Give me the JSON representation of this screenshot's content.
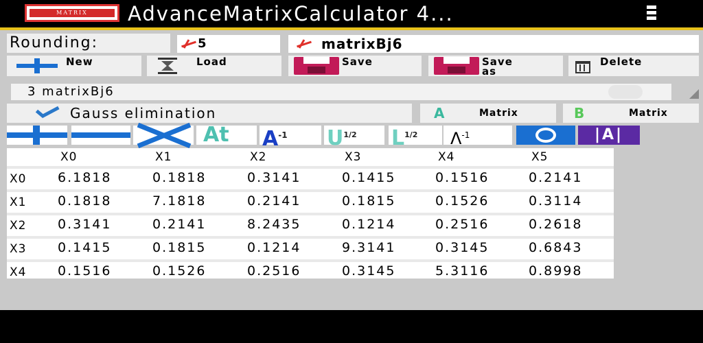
{
  "app": {
    "title": "AdvanceMatrixCalculator 4...",
    "logo_text": "MATRIX"
  },
  "rounding": {
    "label": "Rounding:",
    "value": "5"
  },
  "matrix_name": "matrixBj6",
  "toolbar": {
    "new_label": "New",
    "load_label": "Load",
    "save_label": "Save",
    "saveas_label": "Save as",
    "delete_label": "Delete"
  },
  "selector": {
    "value": "3 matrixBj6"
  },
  "method": {
    "value": "Gauss elimination"
  },
  "matrix_buttons": {
    "a_icon": "A",
    "a_label": "Matrix",
    "b_icon": "B",
    "b_label": "Matrix"
  },
  "operators": {
    "transpose": "At",
    "power": "A",
    "power_sup": "-1",
    "sqrt_u": "U",
    "sqrt_u_sup": "1/2",
    "sqrt_l": "L",
    "sqrt_l_sup": "1/2",
    "eigen": "Λ",
    "eigen_sup": "-1",
    "abs": "|A|"
  },
  "table": {
    "columns": [
      "X0",
      "X1",
      "X2",
      "X3",
      "X4",
      "X5"
    ],
    "rows": [
      {
        "label": "X0",
        "values": [
          "6.1818",
          "0.1818",
          "0.3141",
          "0.1415",
          "0.1516",
          "0.2141"
        ]
      },
      {
        "label": "X1",
        "values": [
          "0.1818",
          "7.1818",
          "0.2141",
          "0.1815",
          "0.1526",
          "0.3114"
        ]
      },
      {
        "label": "X2",
        "values": [
          "0.3141",
          "0.2141",
          "8.2435",
          "0.1214",
          "0.2516",
          "0.2618"
        ]
      },
      {
        "label": "X3",
        "values": [
          "0.1415",
          "0.1815",
          "0.1214",
          "9.3141",
          "0.3145",
          "0.6843"
        ]
      },
      {
        "label": "X4",
        "values": [
          "0.1516",
          "0.1526",
          "0.2516",
          "0.3145",
          "5.3116",
          "0.8998"
        ]
      }
    ]
  },
  "colors": {
    "accent": "#1a6fd1",
    "title_bar": "#000000",
    "title_rule": "#e8c21a",
    "save_icon": "#c21b58",
    "abs_button": "#5b2aa3"
  }
}
